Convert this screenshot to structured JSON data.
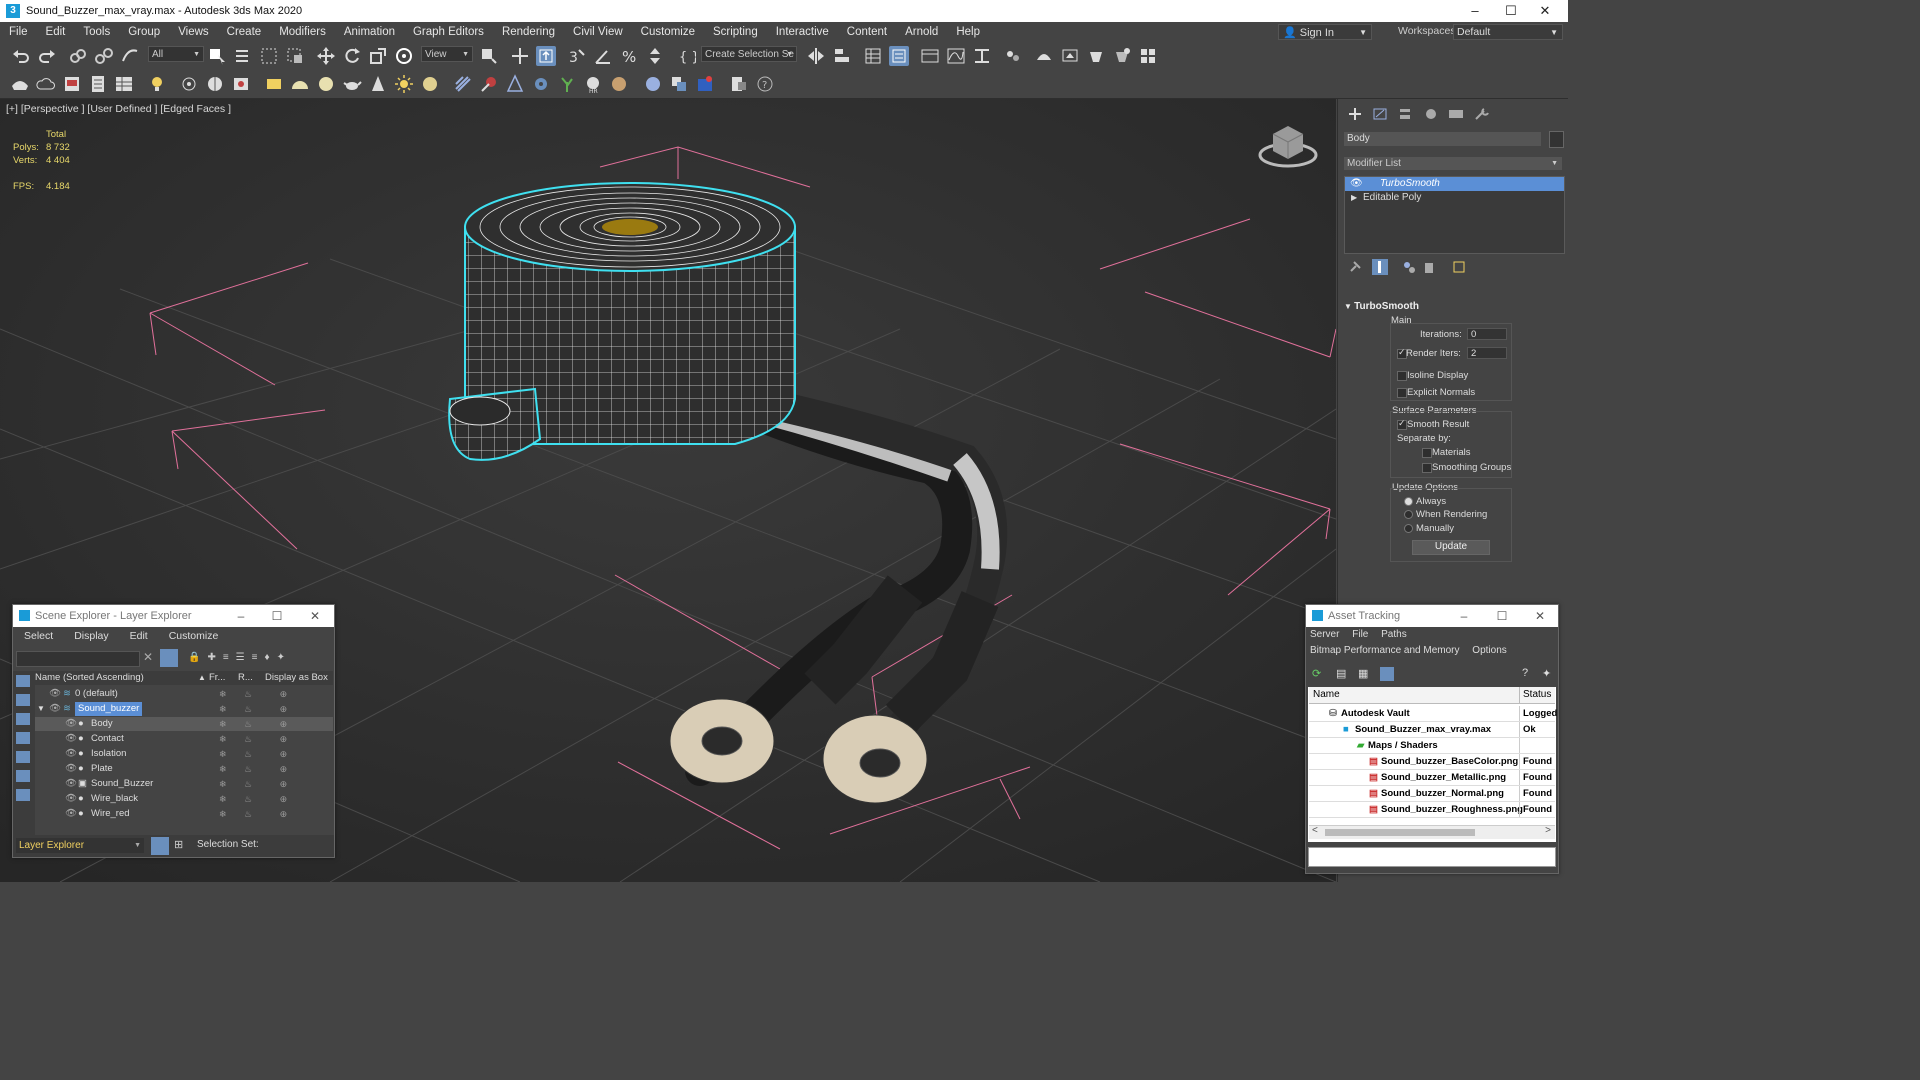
{
  "window": {
    "title": "Sound_Buzzer_max_vray.max - Autodesk 3ds Max 2020"
  },
  "menu": [
    "File",
    "Edit",
    "Tools",
    "Group",
    "Views",
    "Create",
    "Modifiers",
    "Animation",
    "Graph Editors",
    "Rendering",
    "Civil View",
    "Customize",
    "Scripting",
    "Interactive",
    "Content",
    "Arnold",
    "Help"
  ],
  "account": {
    "signin": "Sign In",
    "workspaces_label": "Workspaces:",
    "workspace": "Default"
  },
  "toolbar": {
    "selection_filter": "All",
    "ref_coord": "View",
    "named_selection": "Create Selection Se"
  },
  "viewport": {
    "label": "[+] [Perspective ] [User Defined ] [Edged Faces ]",
    "stats": {
      "header": "Total",
      "polys_label": "Polys:",
      "polys": "8 732",
      "verts_label": "Verts:",
      "verts": "4 404",
      "fps_label": "FPS:",
      "fps": "4.184"
    }
  },
  "command_panel": {
    "object_name": "Body",
    "modifier_list": "Modifier List",
    "stack": [
      "TurboSmooth",
      "Editable Poly"
    ],
    "rollout": "TurboSmooth",
    "main": "Main",
    "iterations_label": "Iterations:",
    "iterations": "0",
    "render_iters_label": "Render Iters:",
    "render_iters": "2",
    "isoline": "Isoline Display",
    "explicit_normals": "Explicit Normals",
    "surface_params": "Surface Parameters",
    "smooth_result": "Smooth Result",
    "separate_by": "Separate by:",
    "materials": "Materials",
    "smoothing_groups": "Smoothing Groups",
    "update_options": "Update Options",
    "always": "Always",
    "when_rendering": "When Rendering",
    "manually": "Manually",
    "update_button": "Update"
  },
  "scene_explorer": {
    "title": "Scene Explorer - Layer Explorer",
    "menu": [
      "Select",
      "Display",
      "Edit",
      "Customize"
    ],
    "columns": [
      "Name (Sorted Ascending)",
      "Fr...",
      "R...",
      "Display as Box"
    ],
    "rows": [
      "0 (default)",
      "Sound_buzzer",
      "Body",
      "Contact",
      "Isolation",
      "Plate",
      "Sound_Buzzer",
      "Wire_black",
      "Wire_red"
    ],
    "footer_mode": "Layer Explorer",
    "selection_set": "Selection Set:"
  },
  "asset_tracking": {
    "title": "Asset Tracking",
    "menu1": [
      "Server",
      "File",
      "Paths"
    ],
    "menu2": [
      "Bitmap Performance and Memory",
      "Options"
    ],
    "col_name": "Name",
    "col_status": "Status",
    "rows": [
      {
        "name": "Autodesk Vault",
        "status": "Logged"
      },
      {
        "name": "Sound_Buzzer_max_vray.max",
        "status": "Ok"
      },
      {
        "name": "Maps / Shaders",
        "status": ""
      },
      {
        "name": "Sound_buzzer_BaseColor.png",
        "status": "Found"
      },
      {
        "name": "Sound_buzzer_Metallic.png",
        "status": "Found"
      },
      {
        "name": "Sound_buzzer_Normal.png",
        "status": "Found"
      },
      {
        "name": "Sound_buzzer_Roughness.png",
        "status": "Found"
      }
    ]
  },
  "colors": {
    "selection_cyan": "#3fe0f0",
    "grid_pink": "#e0709a",
    "highlight_blue": "#5b8fd6"
  }
}
